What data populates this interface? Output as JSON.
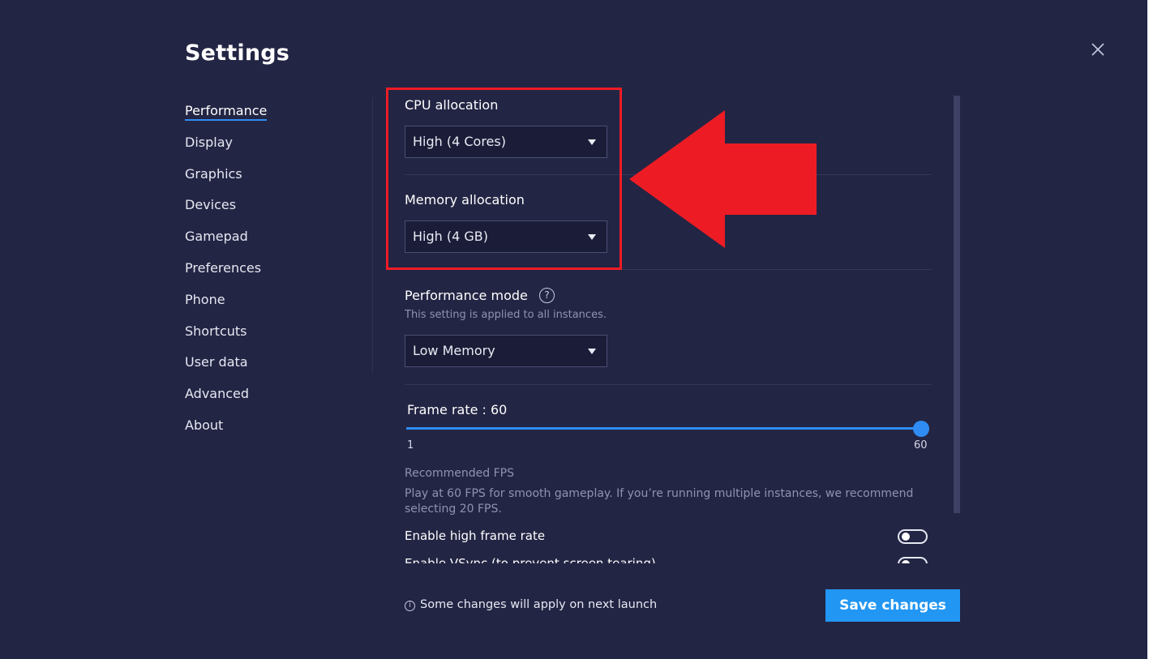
{
  "header": {
    "title": "Settings",
    "close_icon": "close-icon"
  },
  "sidebar": {
    "items": [
      {
        "label": "Performance",
        "active": true
      },
      {
        "label": "Display"
      },
      {
        "label": "Graphics"
      },
      {
        "label": "Devices"
      },
      {
        "label": "Gamepad"
      },
      {
        "label": "Preferences"
      },
      {
        "label": "Phone"
      },
      {
        "label": "Shortcuts"
      },
      {
        "label": "User data"
      },
      {
        "label": "Advanced"
      },
      {
        "label": "About"
      }
    ]
  },
  "performance": {
    "cpu": {
      "label": "CPU allocation",
      "value": "High (4 Cores)"
    },
    "memory": {
      "label": "Memory allocation",
      "value": "High (4 GB)"
    },
    "mode": {
      "label": "Performance mode",
      "help": "?",
      "note": "This setting is applied to all instances.",
      "value": "Low Memory"
    },
    "frame_rate": {
      "label": "Frame rate : 60",
      "min": "1",
      "max": "60",
      "value": 60
    },
    "recommended": {
      "title": "Recommended FPS",
      "text": "Play at 60 FPS for smooth gameplay. If you’re running multiple instances, we recommend selecting 20 FPS."
    },
    "toggles": [
      {
        "label": "Enable high frame rate",
        "on": false
      },
      {
        "label": "Enable VSync (to prevent screen tearing)",
        "on": false
      }
    ]
  },
  "footer": {
    "info_icon": "i",
    "note": "Some changes will apply on next launch",
    "save_label": "Save changes"
  },
  "annotation": {
    "highlight_color": "#ed1c24",
    "arrow_color": "#ed1c24"
  },
  "colors": {
    "background": "#232544",
    "accent": "#2f8cf4",
    "button": "#2196f3"
  }
}
